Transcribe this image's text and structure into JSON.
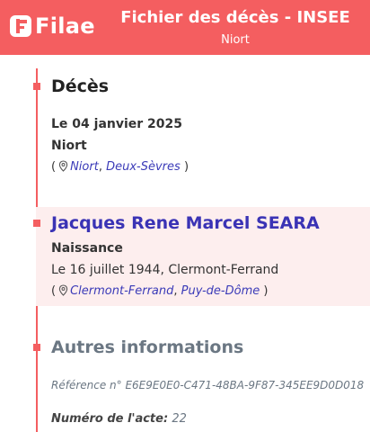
{
  "header": {
    "logo_text": "Filae",
    "title": "Fichier des décès - INSEE",
    "subtitle": "Niort"
  },
  "death": {
    "heading": "Décès",
    "date": "Le 04 janvier 2025",
    "place": "Niort",
    "location": {
      "open": "(",
      "city": "Niort",
      "sep": ",",
      "department": "Deux-Sèvres",
      "close": ")"
    }
  },
  "person": {
    "name": "Jacques Rene Marcel SEARA",
    "birth_label": "Naissance",
    "birth_text": "Le 16 juillet 1944, Clermont-Ferrand",
    "location": {
      "open": "(",
      "city": "Clermont-Ferrand",
      "sep": ",",
      "department": "Puy-de-Dôme",
      "close": ")"
    }
  },
  "other": {
    "heading": "Autres informations",
    "reference": "Référence n° E6E9E0E0-C471-48BA-9F87-345EE9D0D018",
    "acte_label": "Numéro de l'acte:",
    "acte_value": "22"
  },
  "colors": {
    "brand": "#f45e60",
    "link": "#3a33b5",
    "muted": "#6b7783",
    "highlight": "#fdeeee"
  },
  "icons": {
    "logo": "filae-logo-icon",
    "location": "map-pin-icon"
  }
}
